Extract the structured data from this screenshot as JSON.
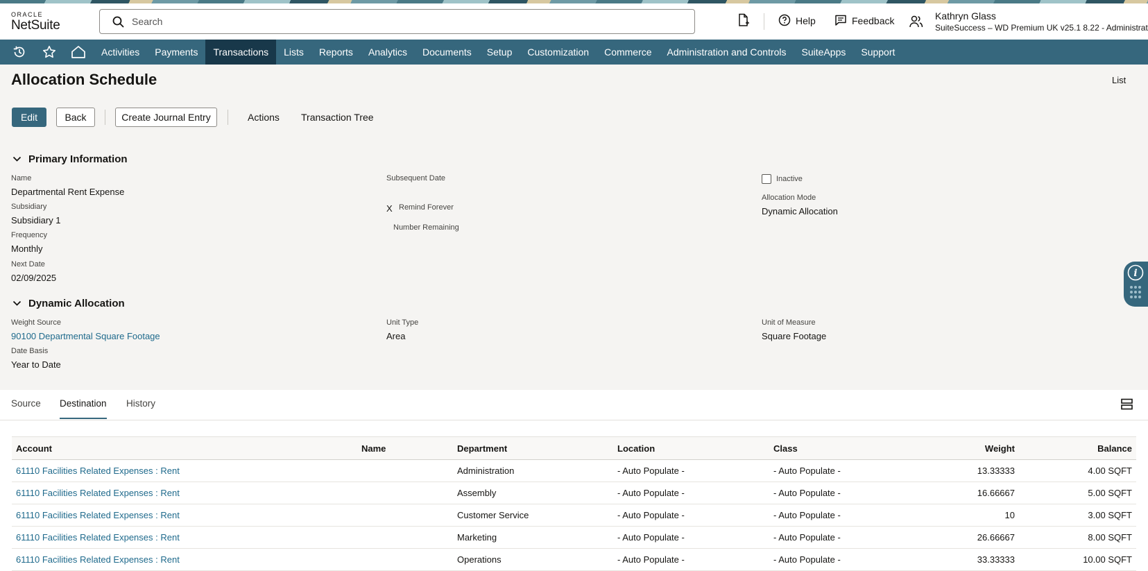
{
  "brand": {
    "oracle": "ORACLE",
    "product": "NetSuite"
  },
  "search": {
    "placeholder": "Search"
  },
  "header": {
    "help": "Help",
    "feedback": "Feedback",
    "user_name": "Kathryn Glass",
    "user_role": "SuiteSuccess – WD Premium UK v25.1 8.22 - Administrator"
  },
  "nav": {
    "items": [
      "Activities",
      "Payments",
      "Transactions",
      "Lists",
      "Reports",
      "Analytics",
      "Documents",
      "Setup",
      "Customization",
      "Commerce",
      "Administration and Controls",
      "SuiteApps",
      "Support"
    ],
    "active": "Transactions"
  },
  "page": {
    "title": "Allocation Schedule",
    "list_link": "List"
  },
  "actions": {
    "edit": "Edit",
    "back": "Back",
    "create_journal_entry": "Create Journal Entry",
    "actions": "Actions",
    "transaction_tree": "Transaction Tree"
  },
  "primary": {
    "heading": "Primary Information",
    "name_label": "Name",
    "name_value": "Departmental Rent Expense",
    "subsidiary_label": "Subsidiary",
    "subsidiary_value": "Subsidiary 1",
    "frequency_label": "Frequency",
    "frequency_value": "Monthly",
    "next_date_label": "Next Date",
    "next_date_value": "02/09/2025",
    "subsequent_date_label": "Subsequent Date",
    "remind_forever_mark": "X",
    "remind_forever_label": "Remind Forever",
    "number_remaining_label": "Number Remaining",
    "inactive_label": "Inactive",
    "inactive_checked": false,
    "allocation_mode_label": "Allocation Mode",
    "allocation_mode_value": "Dynamic Allocation"
  },
  "dynamic": {
    "heading": "Dynamic Allocation",
    "weight_source_label": "Weight Source",
    "weight_source_value": "90100 Departmental Square Footage",
    "date_basis_label": "Date Basis",
    "date_basis_value": "Year to Date",
    "unit_type_label": "Unit Type",
    "unit_type_value": "Area",
    "unit_measure_label": "Unit of Measure",
    "unit_measure_value": "Square Footage"
  },
  "tabs": {
    "source": "Source",
    "destination": "Destination",
    "history": "History",
    "active": "Destination"
  },
  "table": {
    "columns": {
      "account": "Account",
      "name": "Name",
      "department": "Department",
      "location": "Location",
      "class": "Class",
      "weight": "Weight",
      "balance": "Balance"
    },
    "rows": [
      {
        "account": "61110 Facilities Related Expenses : Rent",
        "name": "",
        "department": "Administration",
        "location": "- Auto Populate -",
        "class": "- Auto Populate -",
        "weight": "13.33333",
        "balance": "4.00 SQFT"
      },
      {
        "account": "61110 Facilities Related Expenses : Rent",
        "name": "",
        "department": "Assembly",
        "location": "- Auto Populate -",
        "class": "- Auto Populate -",
        "weight": "16.66667",
        "balance": "5.00 SQFT"
      },
      {
        "account": "61110 Facilities Related Expenses : Rent",
        "name": "",
        "department": "Customer Service",
        "location": "- Auto Populate -",
        "class": "- Auto Populate -",
        "weight": "10",
        "balance": "3.00 SQFT"
      },
      {
        "account": "61110 Facilities Related Expenses : Rent",
        "name": "",
        "department": "Marketing",
        "location": "- Auto Populate -",
        "class": "- Auto Populate -",
        "weight": "26.66667",
        "balance": "8.00 SQFT"
      },
      {
        "account": "61110 Facilities Related Expenses : Rent",
        "name": "",
        "department": "Operations",
        "location": "- Auto Populate -",
        "class": "- Auto Populate -",
        "weight": "33.33333",
        "balance": "10.00 SQFT"
      }
    ]
  },
  "colors": {
    "nav_bg": "#36677d",
    "nav_active": "#18384a",
    "link": "#1f6a8c",
    "page_bg": "#f5f4f2"
  }
}
